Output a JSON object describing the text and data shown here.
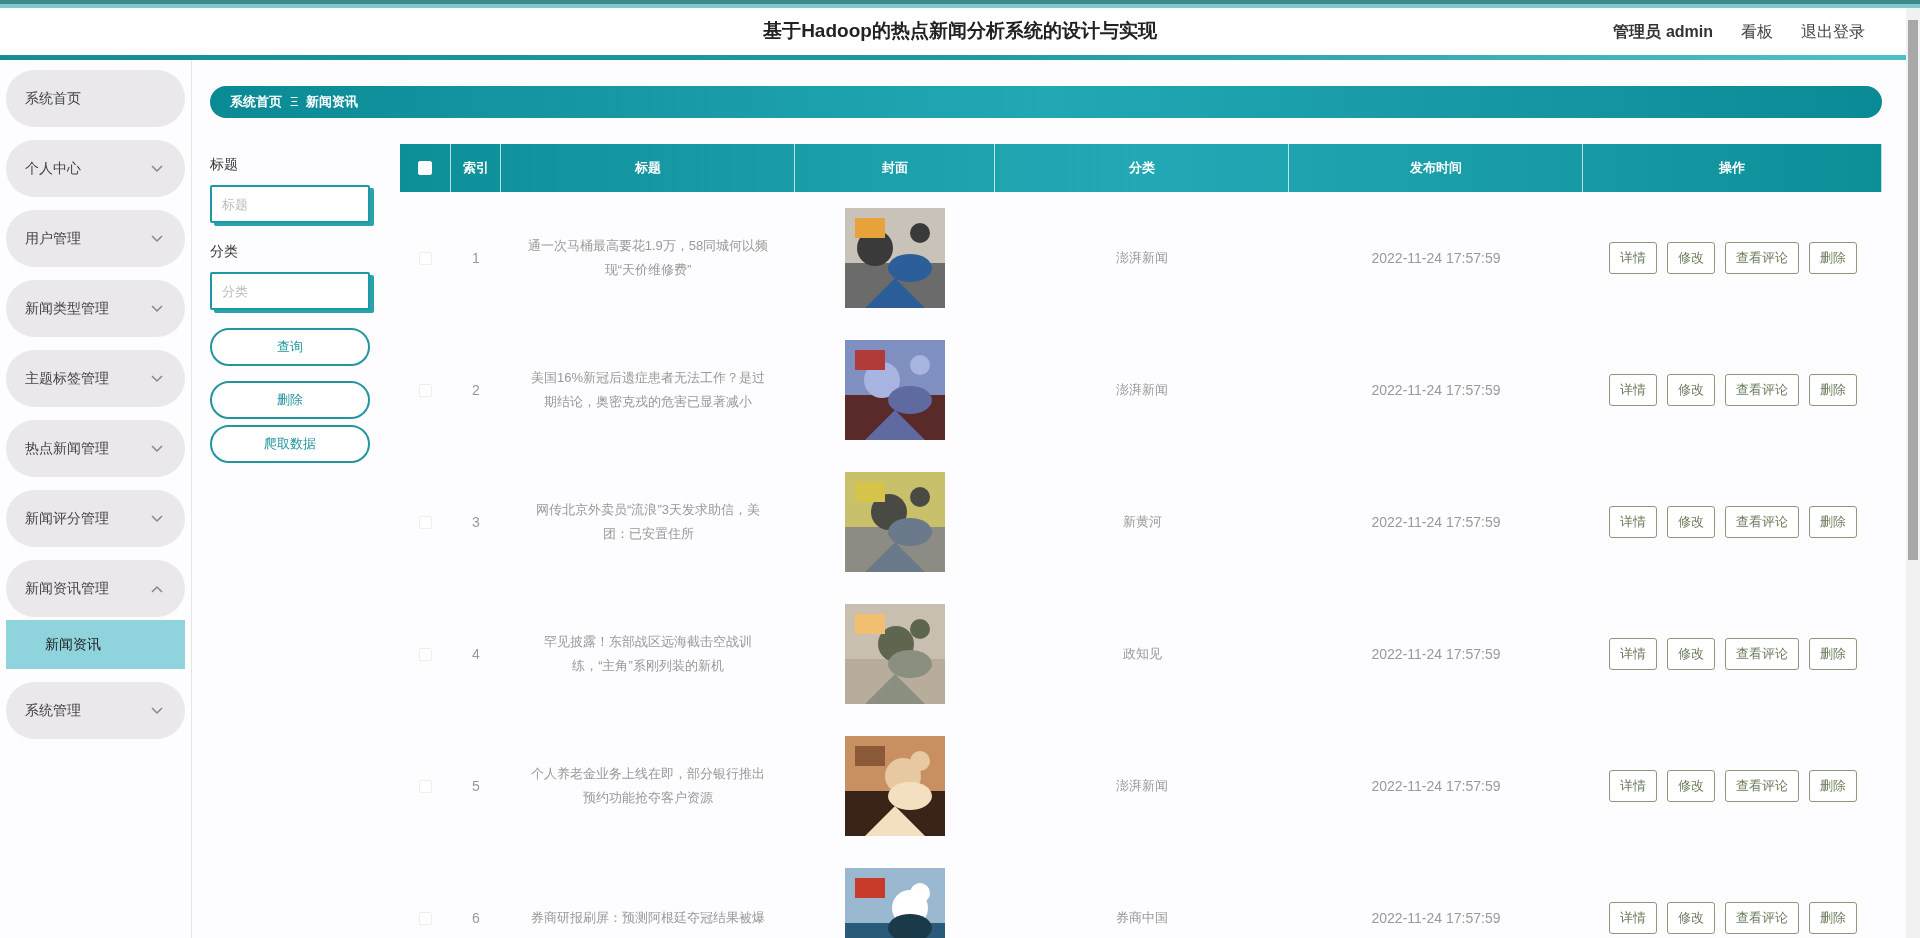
{
  "header": {
    "title": "基于Hadoop的热点新闻分析系统的设计与实现",
    "user": "管理员 admin",
    "links": [
      "看板",
      "退出登录"
    ]
  },
  "sidebar": {
    "items": [
      {
        "label": "系统首页",
        "expandable": false
      },
      {
        "label": "个人中心",
        "expandable": true,
        "expanded": false
      },
      {
        "label": "用户管理",
        "expandable": true,
        "expanded": false
      },
      {
        "label": "新闻类型管理",
        "expandable": true,
        "expanded": false
      },
      {
        "label": "主题标签管理",
        "expandable": true,
        "expanded": false
      },
      {
        "label": "热点新闻管理",
        "expandable": true,
        "expanded": false
      },
      {
        "label": "新闻评分管理",
        "expandable": true,
        "expanded": false
      },
      {
        "label": "新闻资讯管理",
        "expandable": true,
        "expanded": true,
        "children": [
          {
            "label": "新闻资讯",
            "selected": true
          }
        ]
      },
      {
        "label": "系统管理",
        "expandable": true,
        "expanded": false
      }
    ]
  },
  "breadcrumb": {
    "items": [
      "系统首页",
      "新闻资讯"
    ],
    "separator": "Ξ"
  },
  "filters": [
    {
      "label": "标题",
      "placeholder": "标题"
    },
    {
      "label": "分类",
      "placeholder": "分类"
    }
  ],
  "actions": [
    "查询",
    "删除",
    "爬取数据"
  ],
  "table": {
    "select_all": {
      "checked": false
    },
    "columns": [
      "索引",
      "标题",
      "封面",
      "分类",
      "发布时间",
      "操作"
    ],
    "rows": [
      {
        "checked": false,
        "index": "1",
        "title": "通一次马桶最高要花1.9万，58同城何以频现“天价维修费”",
        "category": "澎湃新闻",
        "time": "2022-11-24 17:57:59",
        "buttons": [
          "详情",
          "修改",
          "查看评论",
          "删除"
        ]
      },
      {
        "checked": false,
        "index": "2",
        "title": "美国16%新冠后遗症患者无法工作？是过期结论，奥密克戎的危害已显著减小",
        "category": "澎湃新闻",
        "time": "2022-11-24 17:57:59",
        "buttons": [
          "详情",
          "修改",
          "查看评论",
          "删除"
        ]
      },
      {
        "checked": false,
        "index": "3",
        "title": "网传北京外卖员“流浪”3天发求助信，美团：已安置住所",
        "category": "新黄河",
        "time": "2022-11-24 17:57:59",
        "buttons": [
          "详情",
          "修改",
          "查看评论",
          "删除"
        ]
      },
      {
        "checked": false,
        "index": "4",
        "title": "罕见披露！东部战区远海截击空战训练，“主角”系刚列装的新机",
        "category": "政知见",
        "time": "2022-11-24 17:57:59",
        "buttons": [
          "详情",
          "修改",
          "查看评论",
          "删除"
        ]
      },
      {
        "checked": false,
        "index": "5",
        "title": "个人养老金业务上线在即，部分银行推出预约功能抢夺客户资源",
        "category": "澎湃新闻",
        "time": "2022-11-24 17:57:59",
        "buttons": [
          "详情",
          "修改",
          "查看评论",
          "删除"
        ]
      },
      {
        "checked": false,
        "index": "6",
        "title": "券商研报刷屏：预测阿根廷夺冠结果被爆",
        "category": "券商中国",
        "time": "2022-11-24 17:57:59",
        "buttons": [
          "详情",
          "修改",
          "查看评论",
          "删除"
        ]
      }
    ]
  }
}
